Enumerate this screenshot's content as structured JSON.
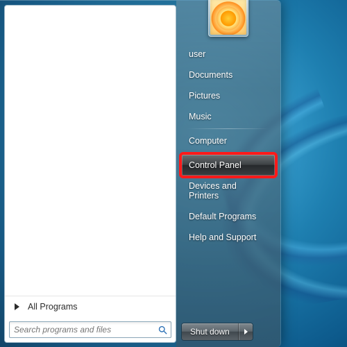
{
  "user": {
    "name": "user"
  },
  "left": {
    "all_programs_label": "All Programs",
    "search_placeholder": "Search programs and files"
  },
  "right": {
    "items": [
      {
        "label": "user"
      },
      {
        "label": "Documents"
      },
      {
        "label": "Pictures"
      },
      {
        "label": "Music"
      },
      {
        "label": "Computer"
      },
      {
        "label": "Control Panel"
      },
      {
        "label": "Devices and Printers"
      },
      {
        "label": "Default Programs"
      },
      {
        "label": "Help and Support"
      }
    ],
    "hover_index": 5,
    "highlight_index": 5
  },
  "shutdown": {
    "label": "Shut down"
  }
}
